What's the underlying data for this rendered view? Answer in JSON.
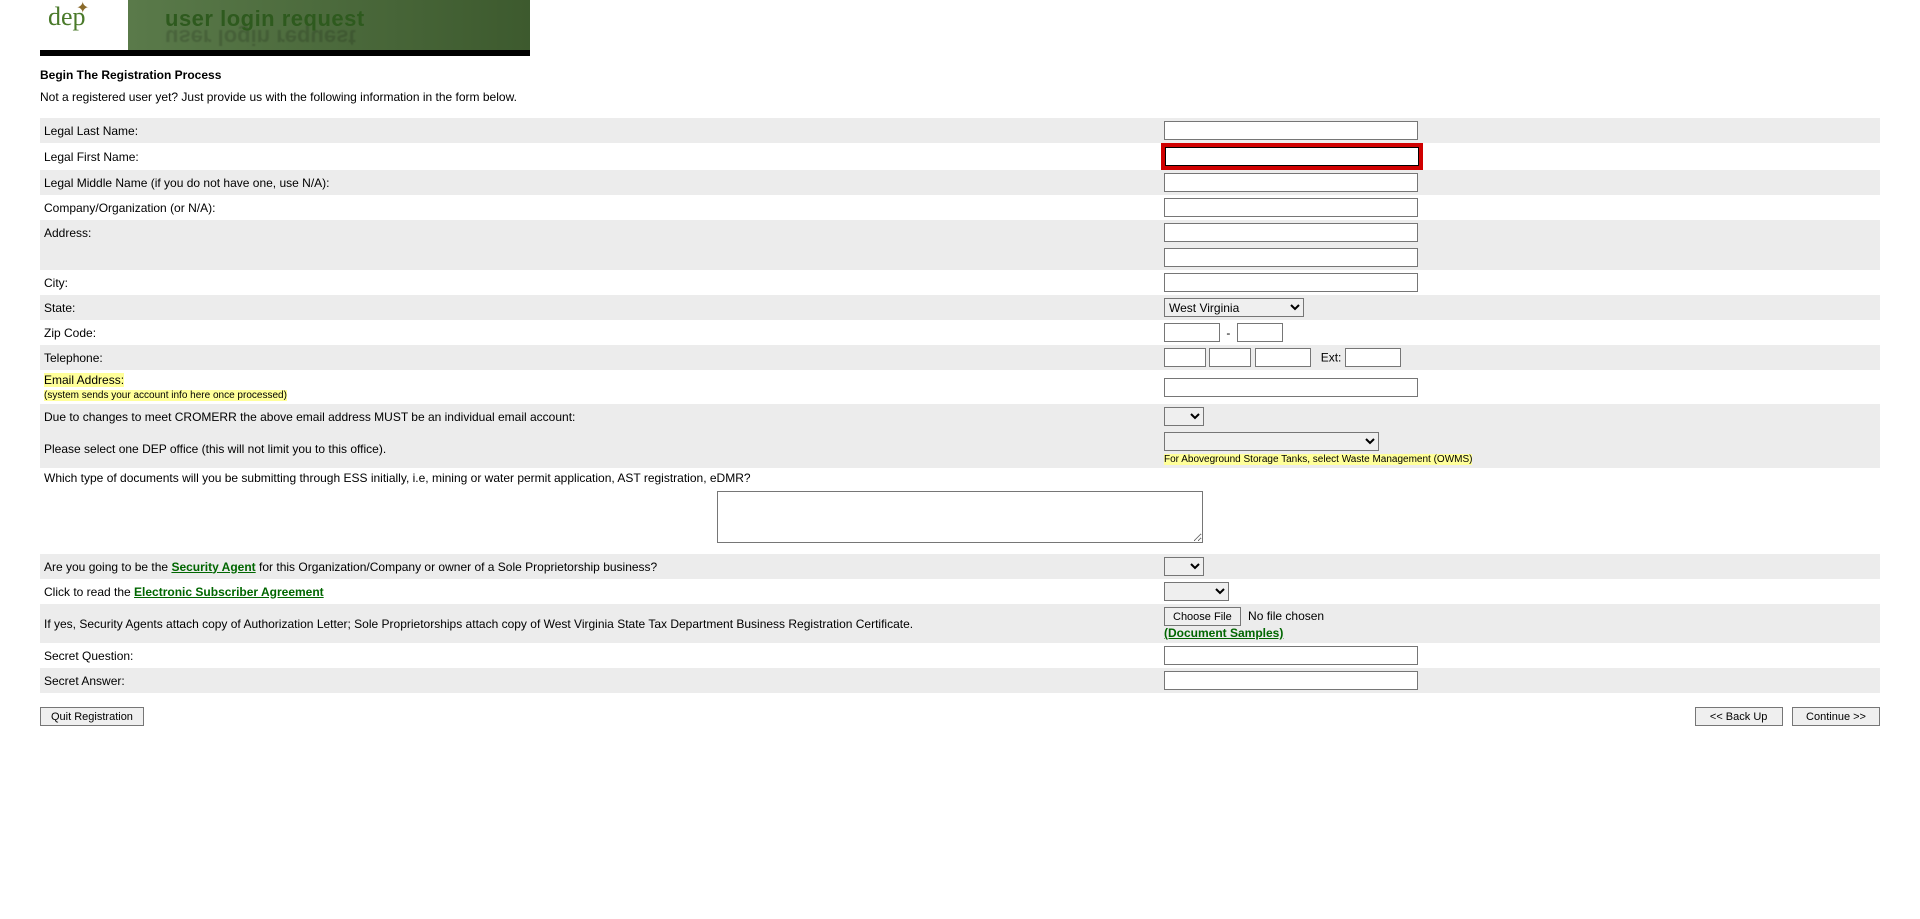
{
  "banner": {
    "logo_text": "dep",
    "title": "user login request"
  },
  "heading": "Begin The Registration Process",
  "intro": "Not a registered user yet? Just provide us with the following information in the form below.",
  "fields": {
    "last_name": {
      "label": "Legal Last Name:"
    },
    "first_name": {
      "label": "Legal First Name:"
    },
    "middle_name": {
      "label": "Legal Middle Name (if you do not have one, use N/A):"
    },
    "company": {
      "label": "Company/Organization (or N/A):"
    },
    "address": {
      "label": "Address:"
    },
    "city": {
      "label": "City:"
    },
    "state": {
      "label": "State:",
      "selected": "West Virginia"
    },
    "zip": {
      "label": "Zip Code:"
    },
    "telephone": {
      "label": "Telephone:",
      "ext_label": "Ext:"
    },
    "email": {
      "label": "Email Address:",
      "note": "(system sends your account info here once processed)"
    },
    "cromerr": {
      "label": "Due to changes to meet CROMERR the above email address MUST be an individual email account:"
    },
    "dep_office": {
      "label": "Please select one DEP office (this will not limit you to this office).",
      "note": "For Aboveground Storage Tanks, select Waste Management (OWMS)"
    },
    "doc_types": {
      "label": "Which type of documents will you be submitting through ESS initially, i.e, mining or water permit application, AST registration, eDMR?"
    },
    "security_agent": {
      "prefix": "Are you going to be the ",
      "link": "Security Agent",
      "suffix": " for this Organization/Company or owner of a Sole Proprietorship business?"
    },
    "esa": {
      "prefix": "Click to read the ",
      "link": "Electronic Subscriber Agreement"
    },
    "attach": {
      "label": "If yes, Security Agents attach copy of Authorization Letter; Sole Proprietorships attach copy of West Virginia State Tax Department Business Registration Certificate.",
      "choose_label": "Choose File",
      "no_file": "No file chosen",
      "samples_link": "(Document Samples)"
    },
    "secret_q": {
      "label": "Secret Question:"
    },
    "secret_a": {
      "label": "Secret Answer:"
    }
  },
  "buttons": {
    "quit": "Quit Registration",
    "back": "<< Back Up",
    "continue": "Continue >>"
  }
}
